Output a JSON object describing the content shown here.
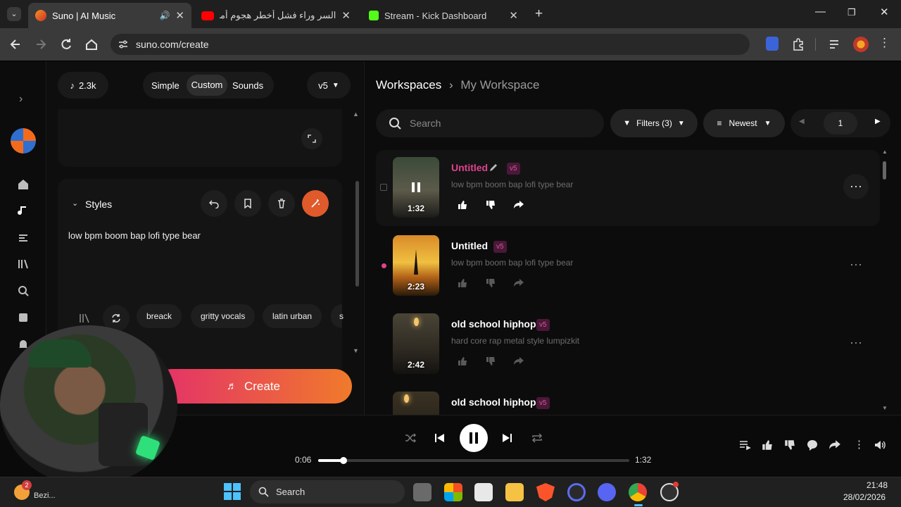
{
  "browser": {
    "tabs": [
      {
        "title": "Suno | AI Music",
        "active": true
      },
      {
        "title": "السر وراء فشل أخطر هجوم أمريكي",
        "active": false
      },
      {
        "title": "Stream - Kick Dashboard",
        "active": false
      }
    ],
    "url": "suno.com/create"
  },
  "create_panel": {
    "credits": "2.3k",
    "modes": [
      "Simple",
      "Custom",
      "Sounds"
    ],
    "active_mode": "Custom",
    "model": "v5",
    "styles_heading": "Styles",
    "styles_text": "low bpm boom bap lofi type bear",
    "style_chips": [
      "breack",
      "gritty vocals",
      "latin urban",
      "s"
    ],
    "create_label": "Create"
  },
  "workspace": {
    "breadcrumb_root": "Workspaces",
    "breadcrumb_current": "My Workspace",
    "search_placeholder": "Search",
    "filters_label": "Filters (3)",
    "sort_label": "Newest",
    "page": "1",
    "songs": [
      {
        "title": "Untitled",
        "version": "v5",
        "description": "low bpm boom bap lofi type bear",
        "duration": "1:32"
      },
      {
        "title": "Untitled",
        "version": "v5",
        "description": "low bpm boom bap lofi type bear",
        "duration": "2:23"
      },
      {
        "title": "old school hiphop",
        "version": "v5",
        "description": "hard core rap metal style lumpizkit",
        "duration": "2:42"
      },
      {
        "title": "old school hiphop",
        "version": "v5",
        "description": "",
        "duration": ""
      }
    ]
  },
  "player": {
    "elapsed": "0:06",
    "total": "1:32",
    "progress": 0.082
  },
  "taskbar": {
    "search_label": "Search",
    "time": "21:48",
    "date": "28/02/2026",
    "weather_badge": "2",
    "weather_label": "Bezi..."
  },
  "colors": {
    "accent_pink": "#e0428f",
    "create_gradient_start": "#e3306a",
    "create_gradient_end": "#f07a2b",
    "badge_bg": "#4a1838"
  }
}
